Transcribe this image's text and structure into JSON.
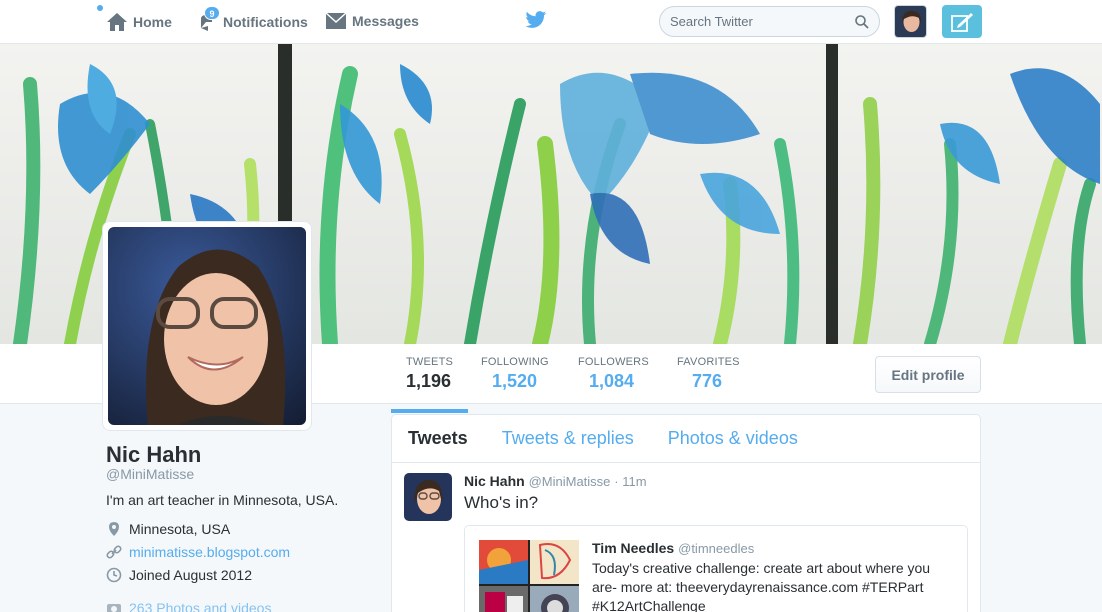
{
  "nav": {
    "home": "Home",
    "notifications": "Notifications",
    "notifications_count": "9",
    "messages": "Messages",
    "search_placeholder": "Search Twitter"
  },
  "stats": [
    {
      "label": "TWEETS",
      "value": "1,196"
    },
    {
      "label": "FOLLOWING",
      "value": "1,520"
    },
    {
      "label": "FOLLOWERS",
      "value": "1,084"
    },
    {
      "label": "FAVORITES",
      "value": "776"
    }
  ],
  "edit_profile": "Edit profile",
  "profile": {
    "name": "Nic Hahn",
    "handle": "@MiniMatisse",
    "bio": "I'm an art teacher in Minnesota, USA.",
    "location": "Minnesota, USA",
    "url": "minimatisse.blogspot.com",
    "joined": "Joined August 2012",
    "photos": "263 Photos and videos"
  },
  "timeline": {
    "tabs": [
      "Tweets",
      "Tweets & replies",
      "Photos & videos"
    ],
    "tweet": {
      "name": "Nic Hahn",
      "handle": "@MiniMatisse",
      "time": "· 11m",
      "text": "Who's in?",
      "quote": {
        "name": "Tim Needles",
        "handle": "@timneedles",
        "text": "Today's creative challenge: create art about where you are- more at: theeverydayrenaissance.com #TERPart #K12ArtChallenge"
      }
    }
  },
  "colors": {
    "accent": "#55acee",
    "text": "#292f33",
    "muted": "#66757f",
    "compose": "#5bc0de"
  }
}
